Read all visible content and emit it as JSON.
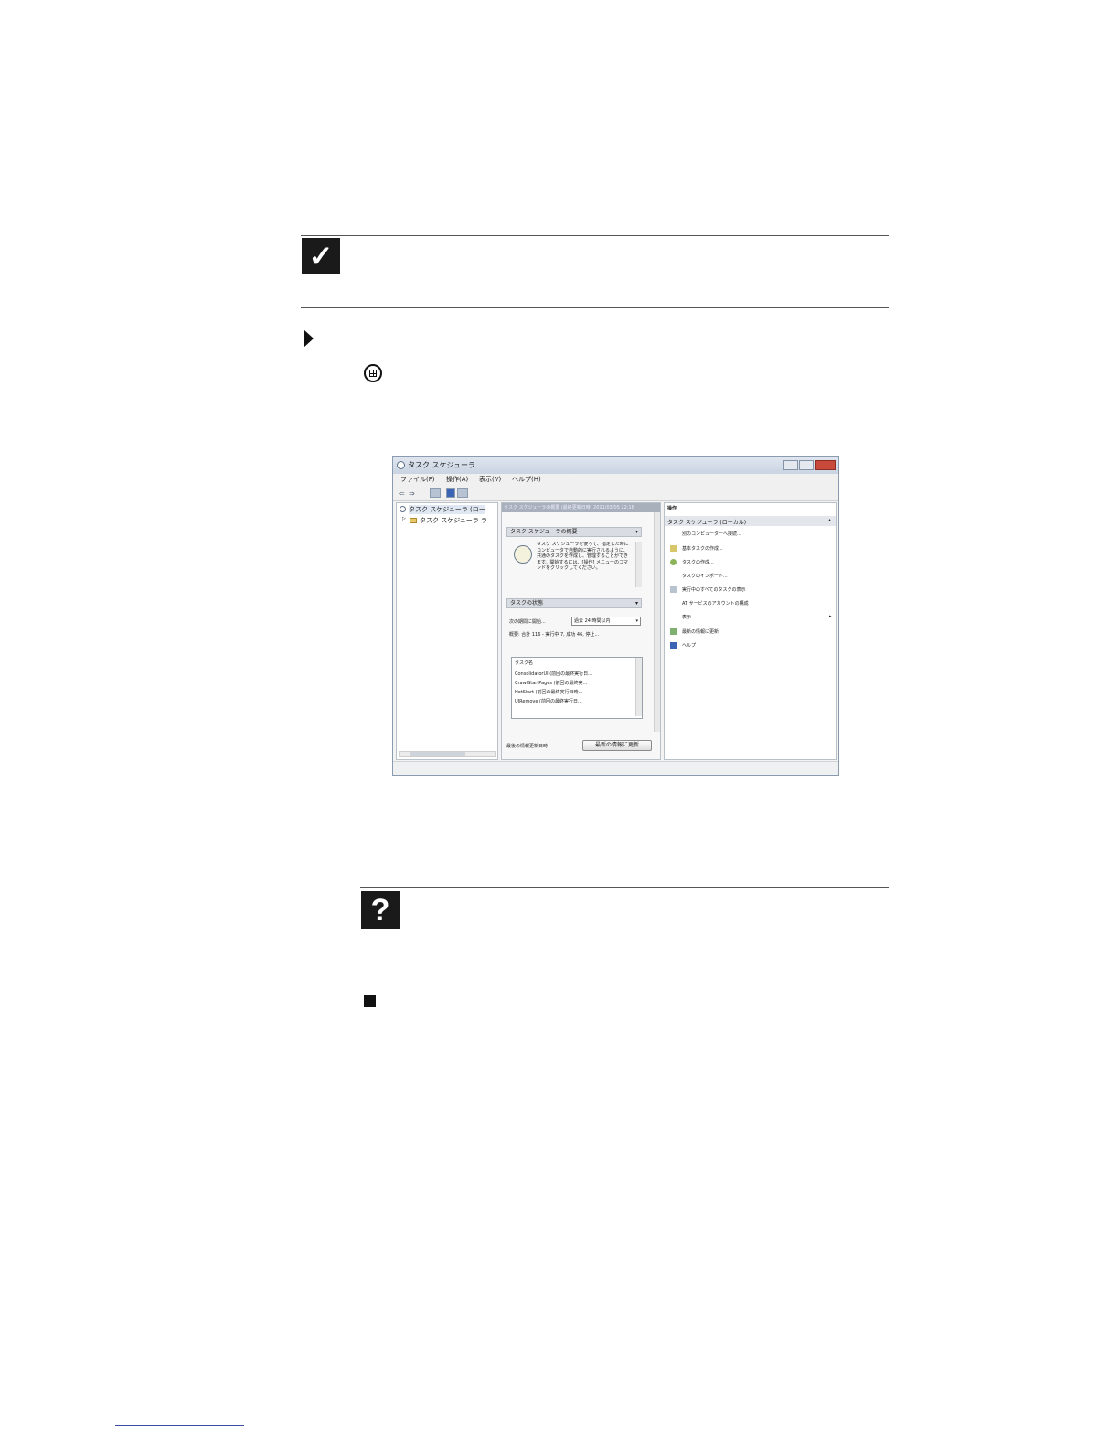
{
  "screenshot": {
    "title": "タスク スケジューラ",
    "menu": [
      "ファイル(F)",
      "操作(A)",
      "表示(V)",
      "ヘルプ(H)"
    ],
    "tree": {
      "root": "タスク スケジューラ (ロー",
      "child": "タスク スケジューラ ラ"
    },
    "center": {
      "header": "タスク スケジューラの概要 (最終更新日時: 2011/03/05 22:18",
      "section_overview": "タスク スケジューラの概要",
      "overview_text": "タスク スケジューラを使って、指定した時にコンピュータで自動的に実行されるように、共通のタスクを作成し、管理することができます。開始するには、[操作] メニューのコマンドをクリックしてください。",
      "section_status": "タスクの状態",
      "status_label": "次の期間に開始...",
      "status_select": "過去 24 時間以内",
      "summary": "概要: 合計 116 - 実行中 7, 成功 46, 停止...",
      "task_header": "タスク名",
      "tasks": [
        "ConsolidatorUI (前回の最終実行日...",
        "CrawlStartPages (前回の最終実...",
        "HotStart (前回の最終実行日時...",
        "UIRemove (前回の最終実行日..."
      ],
      "last_refresh_label": "最後の情報更新日時",
      "refresh_button": "最新の情報に更新"
    },
    "actions": {
      "header": "操作",
      "group": "タスク スケジューラ (ローカル)",
      "items": [
        "別のコンピューターへ接続...",
        "基本タスクの作成...",
        "タスクの作成...",
        "タスクのインポート...",
        "実行中のすべてのタスクの表示",
        "AT サービスのアカウントの構成",
        "表示",
        "最新の情報に更新",
        "ヘルプ"
      ]
    }
  }
}
